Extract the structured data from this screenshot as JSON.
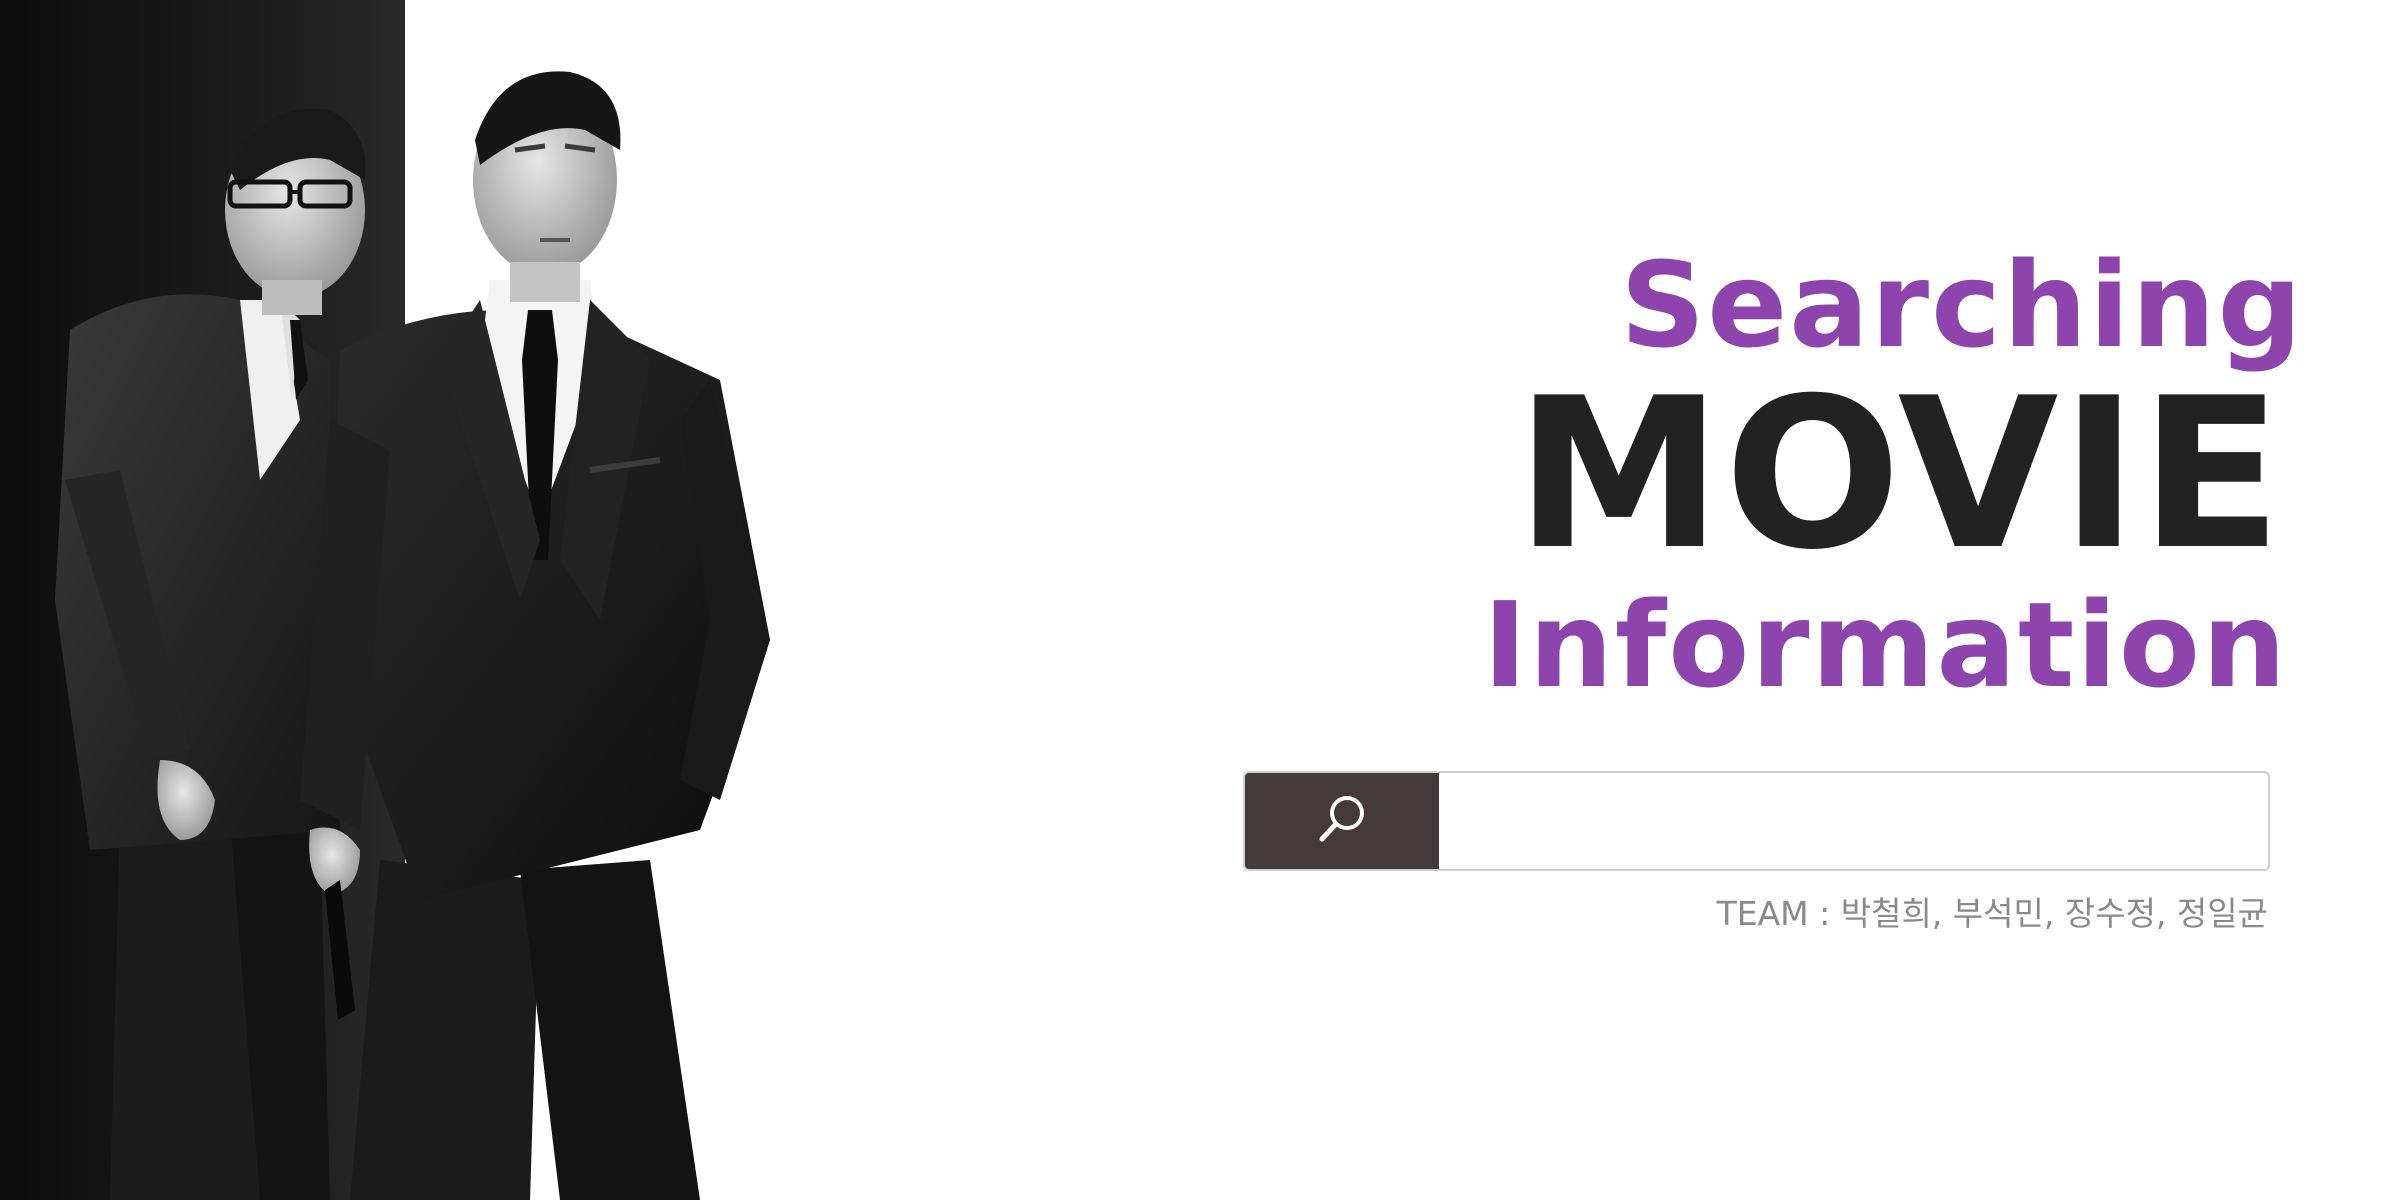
{
  "title": {
    "line1": "Searching",
    "line2": "MOVIE",
    "line3": "Information"
  },
  "search": {
    "value": "",
    "placeholder": "",
    "button_icon": "search-icon"
  },
  "team": {
    "label": "TEAM : 박철희, 부석민, 장수정, 정일균"
  },
  "hero_image": {
    "description_icon": "two-men-in-suits-image"
  },
  "colors": {
    "accent": "#8e44ad",
    "title_dark": "#222222",
    "search_button_bg": "#443a3c",
    "text_muted": "#8a8a8a"
  }
}
